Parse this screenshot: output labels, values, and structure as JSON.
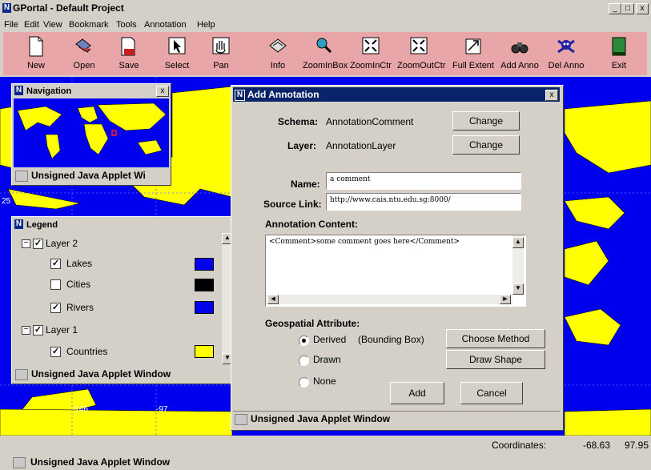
{
  "app": {
    "title": "GPortal - Default Project",
    "win_min": "_",
    "win_max": "□",
    "win_close": "x"
  },
  "menu": [
    "File",
    "Edit",
    "View",
    "Bookmark",
    "Tools",
    "Annotation",
    "Help"
  ],
  "toolbar": [
    {
      "label": "New",
      "icon": "new-document-icon"
    },
    {
      "label": "Open",
      "icon": "open-folder-icon"
    },
    {
      "label": "Save",
      "icon": "save-icon"
    },
    {
      "label": "Select",
      "icon": "select-arrow-icon"
    },
    {
      "label": "Pan",
      "icon": "pan-hand-icon"
    },
    {
      "label": "Info",
      "icon": "info-icon"
    },
    {
      "label": "ZoomInBox",
      "icon": "zoom-in-box-icon"
    },
    {
      "label": "ZoomInCtr",
      "icon": "zoom-in-center-icon"
    },
    {
      "label": "ZoomOutCtr",
      "icon": "zoom-out-center-icon"
    },
    {
      "label": "Full Extent",
      "icon": "full-extent-icon"
    },
    {
      "label": "Add Anno",
      "icon": "add-annotation-binoculars-icon"
    },
    {
      "label": "Del Anno",
      "icon": "delete-annotation-skull-icon"
    },
    {
      "label": "Exit",
      "icon": "exit-door-icon"
    }
  ],
  "colors": {
    "map_water": "#0000ee",
    "map_land": "#ffff00",
    "toolbar_bg": "#e8a6a8",
    "titlebar": "#0a246a"
  },
  "navigation": {
    "title": "Navigation",
    "close": "x",
    "applet_warning": "Unsigned Java Applet Wi"
  },
  "map": {
    "label_25": "25",
    "label_146": "-146",
    "label_97": "-97"
  },
  "legend": {
    "title": "Legend",
    "items": [
      {
        "label": "Layer 2",
        "checked": true,
        "group": true
      },
      {
        "label": "Lakes",
        "checked": true,
        "color": "#0000ee"
      },
      {
        "label": "Cities",
        "checked": false,
        "color": "#000000"
      },
      {
        "label": "Rivers",
        "checked": true,
        "color": "#0000ee"
      },
      {
        "label": "Layer 1",
        "checked": true,
        "group": true
      },
      {
        "label": "Countries",
        "checked": true,
        "color": "#ffff00"
      }
    ],
    "applet_warning": "Unsigned Java Applet Window"
  },
  "dialog": {
    "title": "Add Annotation",
    "close": "x",
    "schema_label": "Schema:",
    "schema_value": "AnnotationComment",
    "layer_label": "Layer:",
    "layer_value": "AnnotationLayer",
    "change_label": "Change",
    "name_label": "Name:",
    "name_value": "a comment",
    "source_label": "Source Link:",
    "source_value": "http://www.cais.ntu.edu.sg:8000/",
    "content_label": "Annotation Content:",
    "content_value": "<Comment>some comment goes here</Comment>",
    "geo_label": "Geospatial Attribute:",
    "derived_label": "Derived",
    "bounding_label": "(Bounding Box)",
    "drawn_label": "Drawn",
    "none_label": "None",
    "choose_method_label": "Choose Method",
    "draw_shape_label": "Draw Shape",
    "add_label": "Add",
    "cancel_label": "Cancel",
    "applet_warning": "Unsigned Java Applet Window"
  },
  "status": {
    "coordinates_label": "Coordinates:",
    "x": "-68.63",
    "y": "97.95"
  },
  "footer": {
    "applet_warning": "Unsigned Java Applet Window"
  }
}
